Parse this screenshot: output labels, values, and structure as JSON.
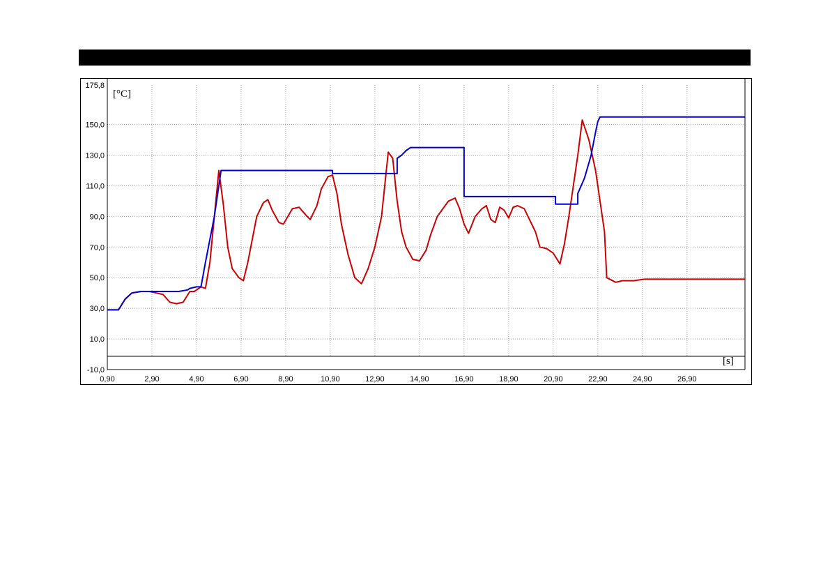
{
  "chart_data": {
    "type": "line",
    "title": "",
    "y_unit": "[°C]",
    "x_unit": "[s]",
    "ylim": [
      -10.0,
      175.8
    ],
    "xlim": [
      0.9,
      29.5
    ],
    "grid": true,
    "legend": "none",
    "y_tick_labels": [
      "175,8",
      "150,0",
      "130,0",
      "110,0",
      "90,0",
      "70,0",
      "50,0",
      "30,0",
      "10,0",
      "-10,0"
    ],
    "y_tick_values": [
      175.8,
      150,
      130,
      110,
      90,
      70,
      50,
      30,
      10,
      -10
    ],
    "x_tick_labels": [
      "0,90",
      "2,90",
      "4,90",
      "6,90",
      "8,90",
      "10,90",
      "12,90",
      "14,90",
      "16,90",
      "18,90",
      "20,90",
      "22,90",
      "24,90",
      "26,90"
    ],
    "x_tick_values": [
      0.9,
      2.9,
      4.9,
      6.9,
      8.9,
      10.9,
      12.9,
      14.9,
      16.9,
      18.9,
      20.9,
      22.9,
      24.9,
      26.9
    ],
    "series": [
      {
        "color": "#cc0000",
        "x": [
          0.9,
          1.4,
          1.7,
          2.0,
          2.4,
          2.8,
          3.1,
          3.4,
          3.7,
          4.0,
          4.3,
          4.6,
          4.8,
          4.9,
          5.1,
          5.3,
          5.5,
          5.7,
          5.9,
          6.1,
          6.3,
          6.5,
          6.8,
          7.0,
          7.2,
          7.4,
          7.6,
          7.9,
          8.1,
          8.3,
          8.6,
          8.8,
          9.0,
          9.2,
          9.5,
          9.8,
          10.0,
          10.3,
          10.5,
          10.8,
          11.0,
          11.2,
          11.4,
          11.7,
          12.0,
          12.3,
          12.6,
          12.9,
          13.2,
          13.5,
          13.7,
          13.9,
          14.1,
          14.3,
          14.6,
          14.9,
          15.2,
          15.4,
          15.7,
          16.0,
          16.2,
          16.5,
          16.7,
          16.9,
          17.1,
          17.4,
          17.7,
          17.9,
          18.1,
          18.3,
          18.5,
          18.7,
          18.9,
          19.1,
          19.3,
          19.6,
          19.9,
          20.1,
          20.3,
          20.6,
          20.9,
          21.2,
          21.4,
          21.6,
          21.8,
          22.0,
          22.2,
          22.5,
          22.8,
          23.0,
          23.2,
          23.3,
          23.7,
          24.0,
          24.5,
          25.0,
          26.0,
          27.0,
          28.0,
          29.5
        ],
        "y": [
          29,
          29,
          36,
          40,
          41,
          41,
          40,
          39,
          34,
          33,
          34,
          41,
          41,
          42,
          44,
          43,
          60,
          90,
          120,
          98,
          70,
          56,
          50,
          48,
          60,
          75,
          90,
          99,
          101,
          94,
          86,
          85,
          90,
          95,
          96,
          91,
          88,
          97,
          108,
          116,
          117,
          105,
          85,
          65,
          50,
          46,
          56,
          70,
          90,
          132,
          128,
          100,
          80,
          70,
          62,
          61,
          68,
          78,
          90,
          96,
          100,
          102,
          95,
          85,
          79,
          90,
          95,
          97,
          88,
          86,
          96,
          94,
          89,
          96,
          97,
          95,
          86,
          80,
          70,
          69,
          66,
          59,
          72,
          90,
          110,
          130,
          153,
          140,
          120,
          100,
          80,
          50,
          47,
          48,
          48,
          49,
          49,
          49,
          49,
          49
        ]
      },
      {
        "color": "#0000cc",
        "x": [
          0.9,
          1.4,
          1.7,
          2.0,
          2.4,
          3.0,
          4.1,
          4.5,
          4.6,
          4.9,
          5.1,
          5.3,
          5.5,
          5.7,
          5.9,
          6.0,
          11.0,
          11.0,
          13.9,
          13.9,
          14.1,
          14.3,
          14.5,
          16.9,
          16.9,
          21.0,
          21.0,
          22.0,
          22.0,
          22.3,
          22.6,
          22.8,
          22.9,
          23.0,
          29.5
        ],
        "y": [
          29,
          29,
          36,
          40,
          41,
          41,
          41,
          42,
          43,
          44,
          44,
          60,
          75,
          90,
          110,
          120,
          120,
          118,
          118,
          128,
          130,
          133,
          135,
          135,
          103,
          103,
          98,
          98,
          105,
          115,
          130,
          145,
          152,
          155,
          155
        ]
      }
    ]
  }
}
